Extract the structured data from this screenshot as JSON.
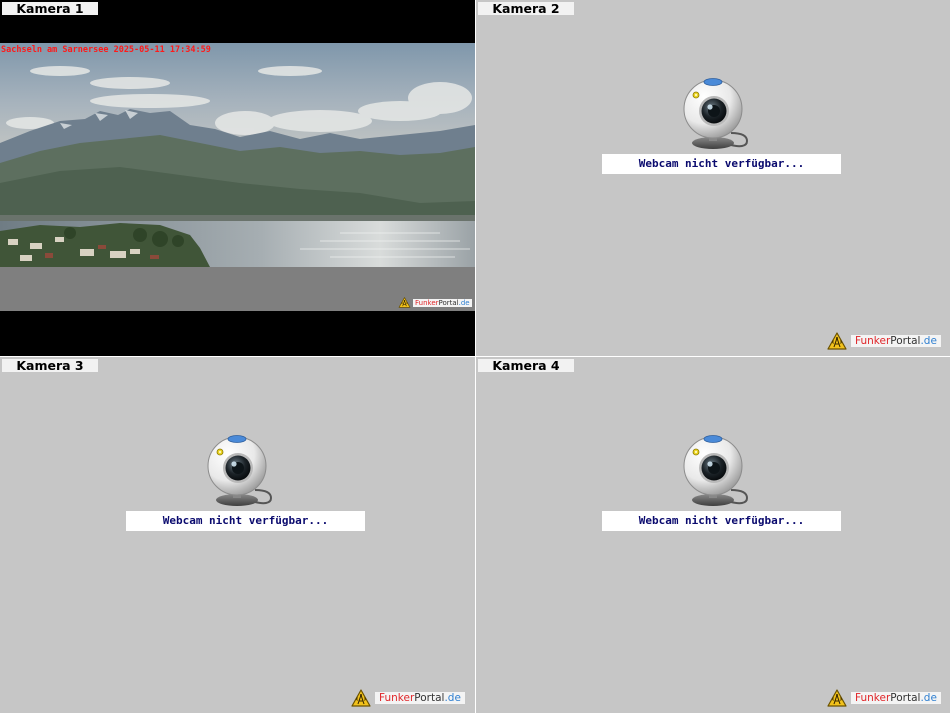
{
  "cameras": [
    {
      "id": "cam1",
      "label": "Kamera 1",
      "status": "live",
      "timestamp_overlay": "Sachseln am Sarnersee 2025-05-11 17:34:59"
    },
    {
      "id": "cam2",
      "label": "Kamera 2",
      "status": "unavailable",
      "message": "Webcam nicht verfügbar..."
    },
    {
      "id": "cam3",
      "label": "Kamera 3",
      "status": "unavailable",
      "message": "Webcam nicht verfügbar..."
    },
    {
      "id": "cam4",
      "label": "Kamera 4",
      "status": "unavailable",
      "message": "Webcam nicht verfügbar..."
    }
  ],
  "watermark": {
    "part1": "Funker",
    "part2": "Portal",
    "part3": ".de"
  },
  "colors": {
    "panel_bg": "#c6c6c6",
    "timestamp": "#ff1a1a",
    "message_text": "#0a0a6e",
    "brand_red": "#e0262a",
    "brand_blue": "#2f7fd0"
  },
  "icons": {
    "offline": "webcam-icon",
    "logo": "radio-tower-icon"
  }
}
